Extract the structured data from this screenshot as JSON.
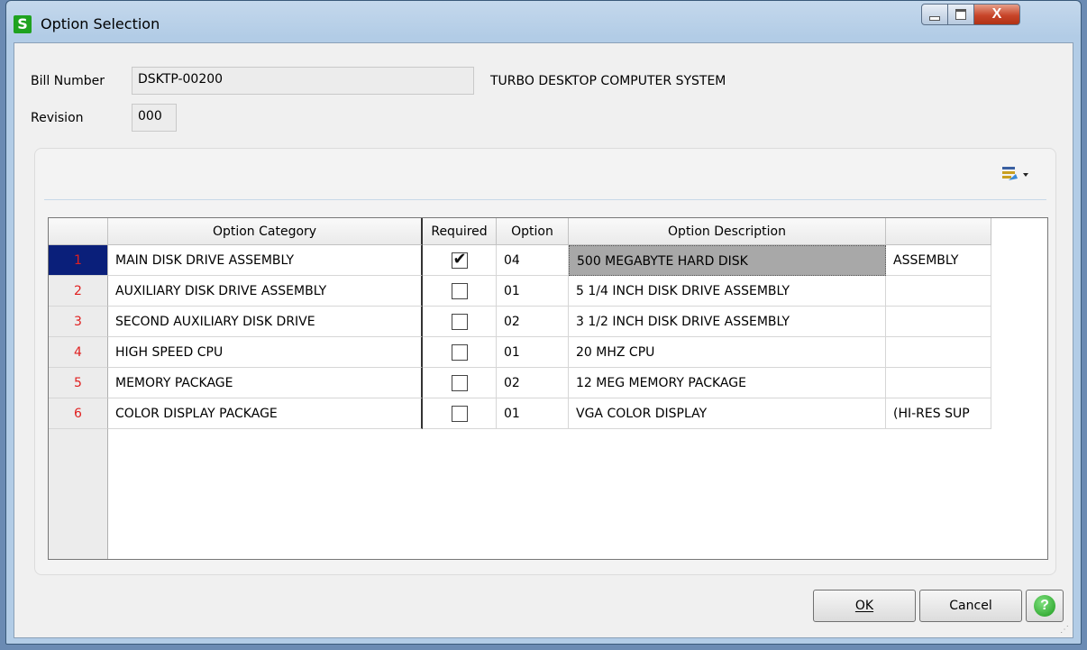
{
  "window": {
    "title": "Option Selection",
    "app_icon_letter": "S",
    "close_glyph": "X"
  },
  "header": {
    "bill_number_label": "Bill Number",
    "bill_number_value": "DSKTP-00200",
    "bill_description": "TURBO DESKTOP COMPUTER SYSTEM",
    "revision_label": "Revision",
    "revision_value": "000"
  },
  "grid": {
    "columns": [
      "Option Category",
      "Required",
      "Option",
      "Option Description",
      ""
    ],
    "rows": [
      {
        "num": "1",
        "category": "MAIN DISK DRIVE ASSEMBLY",
        "required": true,
        "option": "04",
        "description": "500 MEGABYTE HARD DISK",
        "extra": "ASSEMBLY"
      },
      {
        "num": "2",
        "category": "AUXILIARY DISK DRIVE ASSEMBLY",
        "required": false,
        "option": "01",
        "description": "5 1/4 INCH DISK DRIVE ASSEMBLY",
        "extra": ""
      },
      {
        "num": "3",
        "category": "SECOND AUXILIARY DISK DRIVE",
        "required": false,
        "option": "02",
        "description": "3 1/2 INCH DISK DRIVE ASSEMBLY",
        "extra": ""
      },
      {
        "num": "4",
        "category": "HIGH SPEED CPU",
        "required": false,
        "option": "01",
        "description": "20 MHZ CPU",
        "extra": ""
      },
      {
        "num": "5",
        "category": "MEMORY PACKAGE",
        "required": false,
        "option": "02",
        "description": "12 MEG MEMORY PACKAGE",
        "extra": ""
      },
      {
        "num": "6",
        "category": "COLOR DISPLAY PACKAGE",
        "required": false,
        "option": "01",
        "description": "VGA COLOR DISPLAY",
        "extra": "(HI-RES SUP"
      }
    ]
  },
  "buttons": {
    "ok_label": "OK",
    "cancel_label": "Cancel"
  },
  "colors": {
    "row_number": "#e02020",
    "selected_row_number_bg": "#0a1f7a",
    "app_icon": "#1fa21f"
  }
}
